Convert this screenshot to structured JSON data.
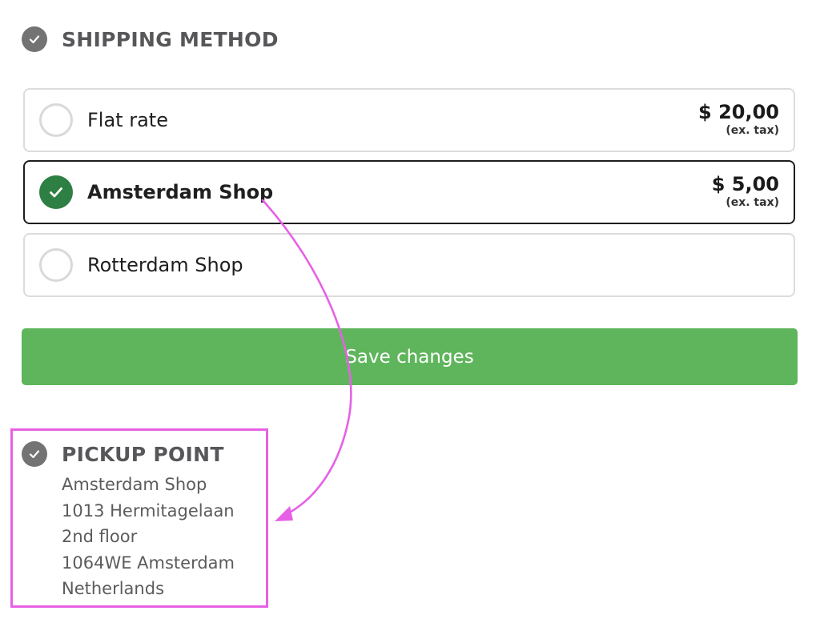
{
  "shipping": {
    "title": "SHIPPING METHOD",
    "options": [
      {
        "label": "Flat rate",
        "price": "$ 20,00",
        "tax_note": "(ex. tax)",
        "selected": false
      },
      {
        "label": "Amsterdam Shop",
        "price": "$ 5,00",
        "tax_note": "(ex. tax)",
        "selected": true
      },
      {
        "label": "Rotterdam Shop",
        "price": "",
        "tax_note": "",
        "selected": false
      }
    ],
    "save_label": "Save changes"
  },
  "pickup": {
    "title": "PICKUP POINT",
    "address_lines": [
      "Amsterdam Shop",
      "1013 Hermitagelaan",
      "2nd floor",
      "1064WE Amsterdam",
      "Netherlands"
    ]
  },
  "colors": {
    "accent_green": "#5fb55b",
    "radio_checked": "#2e7f43",
    "annotation_magenta": "#e661e6",
    "heading_grey": "#575659"
  },
  "icons": {
    "section_check": "check-circle-icon",
    "radio_check": "checkmark-icon",
    "annotation": "curved-arrow-icon"
  }
}
